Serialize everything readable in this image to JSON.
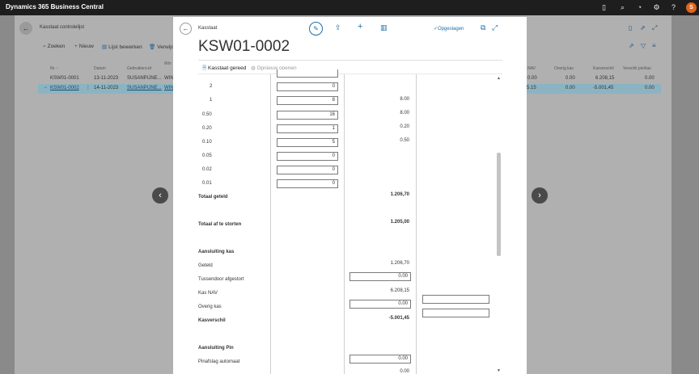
{
  "topbar": {
    "brand": "Dynamics 365 Business Central",
    "avatar": "S"
  },
  "background": {
    "breadcrumb": "Kasstaat controlelijst",
    "tools": {
      "search": "Zoeken",
      "new": "Nieuw",
      "edit_list": "Lijst bewerken",
      "delete": "Verwijd"
    },
    "headers": {
      "nr": "Nr. ↑",
      "datum": "Datum",
      "gebruiker": "Gebruikers-id",
      "win": "Win",
      "nav": "NAV",
      "overig": "Overig kas",
      "kasverschil": "Kasverschil",
      "verschil_pin": "Verschil pin/kas"
    },
    "rows": [
      {
        "nr": "KSW01-0001",
        "datum": "13-11-2023",
        "gebruiker": "SUSANPIJNE...",
        "win": "WIN",
        "nav": "0.00",
        "overig": "0.00",
        "kasverschil": "6.208,15",
        "verschil_pin": "0.00"
      },
      {
        "nr": "KSW01-0002",
        "datum": "14-11-2023",
        "gebruiker": "SUSANPIJNE...",
        "win": "WIN",
        "nav": "5.15",
        "overig": "0.00",
        "kasverschil": "-5.001,45",
        "verschil_pin": "0.00"
      }
    ]
  },
  "dialog": {
    "breadcrumb": "Kasstaat",
    "title": "KSW01-0002",
    "saved": "Opgeslagen",
    "btn_ready": "Kasstaat gereed",
    "btn_reopen": "Opnieuw openen",
    "denoms": [
      {
        "label": "2",
        "count": "0",
        "amount": ""
      },
      {
        "label": "1",
        "count": "8",
        "amount": "8.00"
      },
      {
        "label": "0.50",
        "count": "16",
        "amount": "8.00"
      },
      {
        "label": "0.20",
        "count": "1",
        "amount": "0.20"
      },
      {
        "label": "0.10",
        "count": "5",
        "amount": "0.50"
      },
      {
        "label": "0.05",
        "count": "0",
        "amount": ""
      },
      {
        "label": "0.02",
        "count": "0",
        "amount": ""
      },
      {
        "label": "0.01",
        "count": "0",
        "amount": ""
      }
    ],
    "totaal_geteld": {
      "label": "Totaal geteld",
      "value": "1.206,70"
    },
    "totaal_af": {
      "label": "Totaal af te storten",
      "value": "1.205,00"
    },
    "aansluiting_kas": "Aansluiting kas",
    "geteld": {
      "label": "Geteld",
      "value": "1.206,70"
    },
    "tussendoor": {
      "label": "Tussendoor afgestort",
      "value": "0.00"
    },
    "kas_nav": {
      "label": "Kas NAV",
      "value": "6.208,15"
    },
    "overig_kas": {
      "label": "Overig kas",
      "value": "0.00"
    },
    "kasverschil": {
      "label": "Kasverschil",
      "value": "-5.001,45"
    },
    "aansluiting_pin": "Aansluiting Pin",
    "pinafslag": {
      "label": "Pinafslag automaat",
      "value": "0.00"
    },
    "bottom_value": "0.00"
  }
}
